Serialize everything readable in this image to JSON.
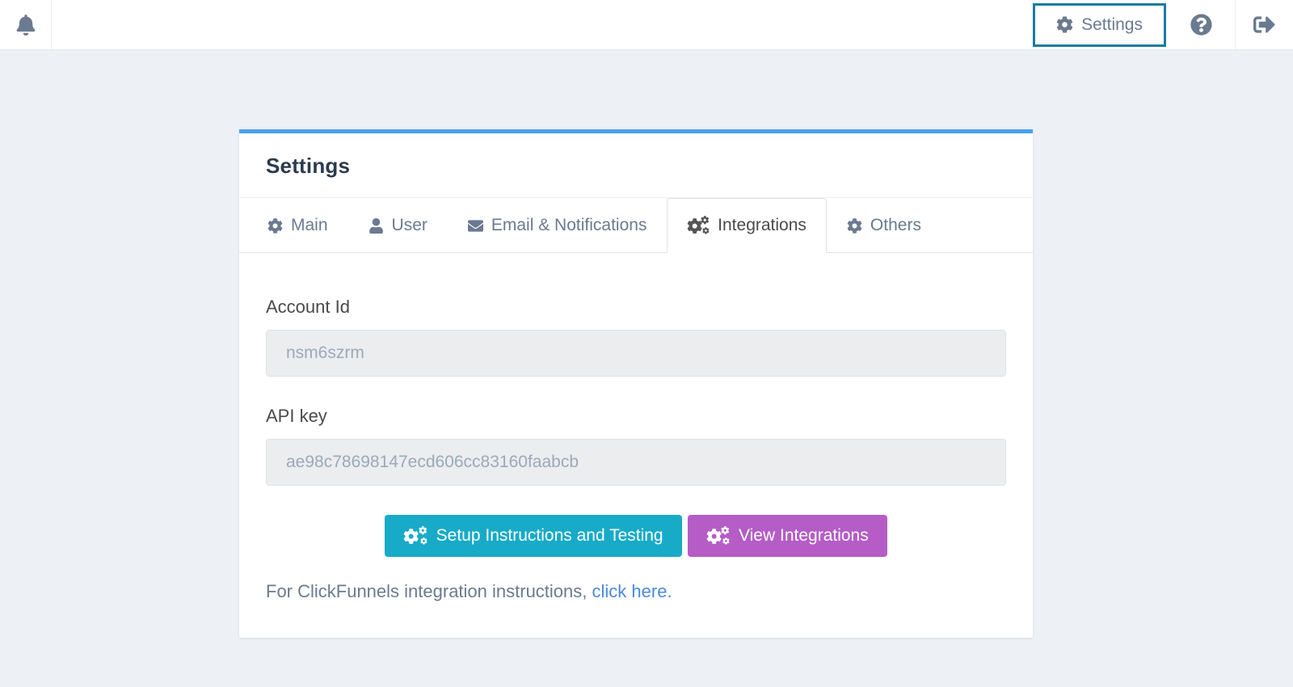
{
  "topbar": {
    "settings_button_label": "Settings",
    "icons": {
      "bell": "bell-icon",
      "gear": "gear-icon",
      "help": "question-circle-icon",
      "signout": "sign-out-icon"
    }
  },
  "card": {
    "title": "Settings",
    "tabs": [
      {
        "label": "Main",
        "icon": "gear-icon",
        "active": false
      },
      {
        "label": "User",
        "icon": "user-icon",
        "active": false
      },
      {
        "label": "Email & Notifications",
        "icon": "envelope-icon",
        "active": false
      },
      {
        "label": "Integrations",
        "icon": "gears-icon",
        "active": true
      },
      {
        "label": "Others",
        "icon": "gear-icon",
        "active": false
      }
    ],
    "form": {
      "account_id": {
        "label": "Account Id",
        "value": "nsm6szrm"
      },
      "api_key": {
        "label": "API key",
        "value": "ae98c78698147ecd606cc83160faabcb"
      }
    },
    "buttons": {
      "setup_label": "Setup Instructions and Testing",
      "view_label": "View Integrations"
    },
    "footer": {
      "text": "For ClickFunnels integration instructions,",
      "link": "click here",
      "suffix": "."
    }
  },
  "colors": {
    "page_background": "#edf0f4",
    "card_top_border": "#4aa0ef",
    "topbar_button_border": "#1a7ca2",
    "teal_button": "#17abc8",
    "purple_button": "#b55cc7",
    "link_blue": "#4a89dc",
    "icon_gray": "#6b7a90",
    "heading_text": "#2b3a4f",
    "input_background": "#ebedee",
    "input_text": "#9aa9bb"
  }
}
